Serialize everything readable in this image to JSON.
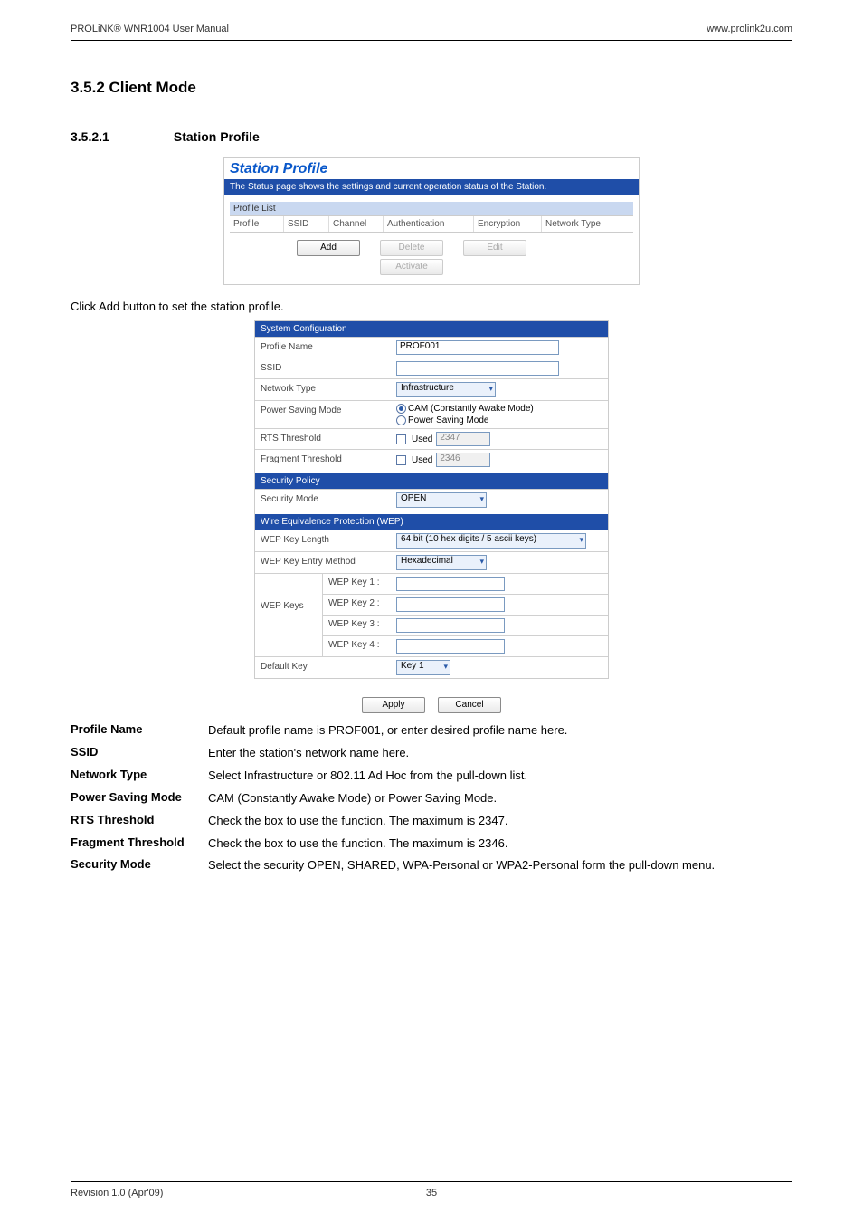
{
  "header": {
    "left": "PROLiNK® WNR1004 User Manual",
    "right": "www.prolink2u.com"
  },
  "headings": {
    "h2": "3.5.2  Client Mode",
    "h3_num": "3.5.2.1",
    "h3_text": "Station Profile"
  },
  "fig1": {
    "title": "Station Profile",
    "bluebar": "The Status page shows the settings and current operation status of the Station.",
    "list_head": "Profile List",
    "cols": [
      "Profile",
      "SSID",
      "Channel",
      "Authentication",
      "Encryption",
      "Network Type"
    ],
    "buttons": {
      "add": "Add",
      "delete": "Delete",
      "activate": "Activate",
      "edit": "Edit"
    }
  },
  "body_text": "Click Add button to set the station profile.",
  "fig2": {
    "sec1": "System Configuration",
    "rows": {
      "profile_name_l": "Profile Name",
      "profile_name_v": "PROF001",
      "ssid_l": "SSID",
      "nettype_l": "Network Type",
      "nettype_v": "Infrastructure",
      "psm_l": "Power Saving Mode",
      "psm_opt1": "CAM (Constantly Awake Mode)",
      "psm_opt2": "Power Saving Mode",
      "rts_l": "RTS Threshold",
      "rts_chk": "Used",
      "rts_v": "2347",
      "frag_l": "Fragment Threshold",
      "frag_chk": "Used",
      "frag_v": "2346"
    },
    "sec2": "Security Policy",
    "secmode_l": "Security Mode",
    "secmode_v": "OPEN",
    "sec3": "Wire Equivalence Protection (WEP)",
    "wep": {
      "len_l": "WEP Key Length",
      "len_v": "64 bit (10 hex digits / 5 ascii keys)",
      "entry_l": "WEP Key Entry Method",
      "entry_v": "Hexadecimal",
      "keys_l": "WEP Keys",
      "k1": "WEP Key 1 :",
      "k2": "WEP Key 2 :",
      "k3": "WEP Key 3 :",
      "k4": "WEP Key 4 :",
      "def_l": "Default Key",
      "def_v": "Key 1"
    },
    "btn_apply": "Apply",
    "btn_cancel": "Cancel"
  },
  "desc": {
    "items": [
      {
        "label": "Profile Name",
        "value": "Default profile name is PROF001, or enter desired profile name here."
      },
      {
        "label": "SSID",
        "value": "Enter the station's network name here."
      },
      {
        "label": "Network Type",
        "value": "Select Infrastructure or 802.11 Ad Hoc from the pull-down list."
      },
      {
        "label": "Power Saving Mode",
        "value": "CAM (Constantly Awake Mode) or Power Saving Mode."
      },
      {
        "label": "RTS Threshold",
        "value": "Check the box to use the function. The maximum is 2347."
      },
      {
        "label": "Fragment Threshold",
        "value": "Check the box to use the function. The maximum is 2346."
      },
      {
        "label": "Security Mode",
        "value": "Select the security OPEN, SHARED, WPA-Personal or WPA2-Personal form the pull-down menu."
      }
    ]
  },
  "footer": {
    "left": "Revision 1.0 (Apr'09)",
    "page": "35"
  }
}
